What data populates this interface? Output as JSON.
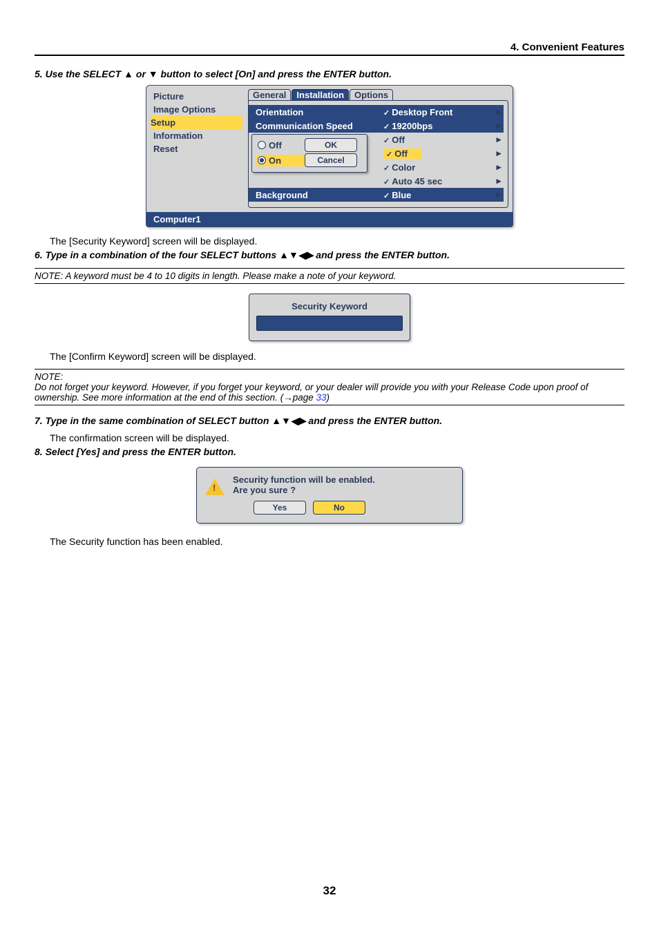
{
  "header": {
    "section_title": "4. Convenient Features"
  },
  "steps": {
    "s5": "5.  Use the SELECT ▲ or ▼ button to select [On] and press the ENTER button.",
    "s5_after": "The [Security Keyword] screen will be displayed.",
    "s6": "6.  Type in a combination of the four SELECT buttons  ▲▼◀▶ and press the ENTER button.",
    "s6_after": "The [Confirm Keyword] screen will be displayed.",
    "s7": "7.  Type in the same combination of SELECT button ▲▼◀▶  and press the ENTER button.",
    "s7_after": "The confirmation screen will be displayed.",
    "s8": "8.  Select [Yes] and press the ENTER button.",
    "s8_after": "The Security function has been enabled."
  },
  "notes": {
    "n1": "NOTE: A keyword must be 4 to 10  digits in length. Please make a note of your keyword.",
    "n2a": "NOTE:",
    "n2b": "Do not forget your keyword. However, if you forget your keyword,  or your dealer will provide you with your Release Code upon proof of ownership. See more information at the end of this section. (→page ",
    "n2c": "33",
    "n2d": ")"
  },
  "osd": {
    "left_menu": [
      "Picture",
      "Image Options",
      "Setup",
      "Information",
      "Reset"
    ],
    "tabs": [
      "General",
      "Installation",
      "Options"
    ],
    "rows": {
      "orientation": {
        "label": "Orientation",
        "value": "Desktop Front"
      },
      "comm": {
        "label": "Communication Speed",
        "value": "19200bps"
      },
      "r3": {
        "label": "",
        "value": "Off"
      },
      "r4": {
        "label": "",
        "value": "Off"
      },
      "r5": {
        "label": "",
        "value": "Color"
      },
      "r6": {
        "label": "",
        "value": "Auto 45 sec"
      },
      "background": {
        "label": "Background",
        "value": "Blue"
      }
    },
    "popup": {
      "off": "Off",
      "on": "On",
      "ok": "OK",
      "cancel": "Cancel"
    },
    "footer": "Computer1"
  },
  "skw": {
    "title": "Security Keyword"
  },
  "confirm": {
    "line1": "Security function will be enabled.",
    "line2": "Are you sure ?",
    "yes": "Yes",
    "no": "No"
  },
  "page_number": "32"
}
